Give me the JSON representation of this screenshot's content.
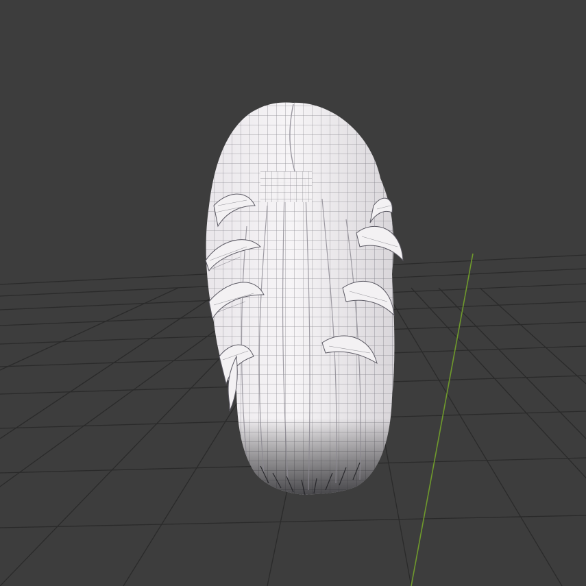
{
  "viewport": {
    "background": "#3d3d3d",
    "grid_color": "#2a2a2a",
    "y_axis_color": "#6f9a2c"
  },
  "model": {
    "type": "hair-mesh-wireframe",
    "base_color": "#f0eef0",
    "shadow_color": "#c9c5ca",
    "wire_color": "#3a3a44"
  }
}
